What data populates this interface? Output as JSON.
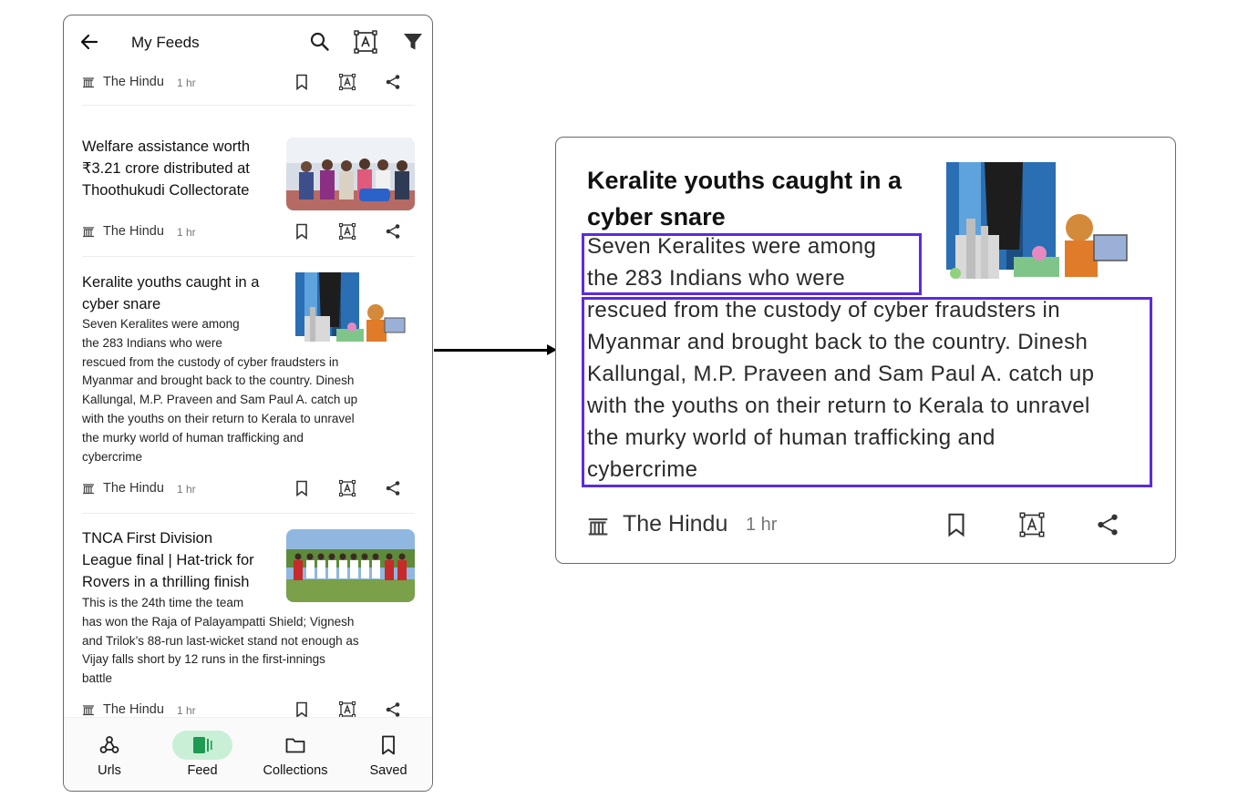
{
  "header": {
    "title": "My Feeds"
  },
  "feed": {
    "items": [
      {
        "source": "The Hindu",
        "time": "1 hr"
      },
      {
        "title_lines": [
          "Welfare assistance worth",
          "₹3.21 crore distributed at",
          "Thoothukudi Collectorate"
        ],
        "source": "The Hindu",
        "time": "1 hr"
      },
      {
        "title_lines": [
          "Keralite youths caught in a",
          "cyber snare"
        ],
        "summary_lines": [
          "Seven Keralites were among",
          "the 283 Indians who were",
          "rescued from the custody of cyber fraudsters in",
          "Myanmar and brought back to the country. Dinesh",
          "Kallungal, M.P. Praveen and Sam Paul A. catch up",
          "with the youths on their return to Kerala to unravel",
          "the murky world of human trafficking and",
          "cybercrime"
        ],
        "source": "The Hindu",
        "time": "1 hr"
      },
      {
        "title_lines": [
          "TNCA First Division",
          "League final | Hat-trick for",
          "Rovers in a thrilling finish"
        ],
        "summary_lines": [
          "This is the 24th time the team",
          "has won the Raja of Palayampatti Shield; Vignesh",
          "and Trilok’s 88-run last-wicket stand not enough as",
          "Vijay falls short by 12 runs in the first-innings",
          "battle"
        ],
        "source": "The Hindu",
        "time": "1 hr"
      }
    ]
  },
  "bottom_nav": [
    {
      "label": "Urls",
      "icon": "webhook-icon",
      "active": false
    },
    {
      "label": "Feed",
      "icon": "feed-icon",
      "active": true
    },
    {
      "label": "Collections",
      "icon": "folder-icon",
      "active": false
    },
    {
      "label": "Saved",
      "icon": "bookmark-icon",
      "active": false
    }
  ],
  "zoom": {
    "title_lines": [
      "Keralite youths caught in a",
      "cyber snare"
    ],
    "summary_lines": [
      "Seven Keralites were among",
      "the 283 Indians who were",
      "rescued from the custody of cyber fraudsters in",
      "Myanmar and brought back to the country. Dinesh",
      "Kallungal, M.P. Praveen and Sam Paul A. catch up",
      "with the youths on their return to Kerala to unravel",
      "the murky world of human trafficking and",
      "cybercrime"
    ],
    "source": "The Hindu",
    "time": "1 hr"
  },
  "colors": {
    "accent": "#c9f0d6",
    "active_icon": "#1f9a52",
    "highlight": "#5b2bdb"
  }
}
